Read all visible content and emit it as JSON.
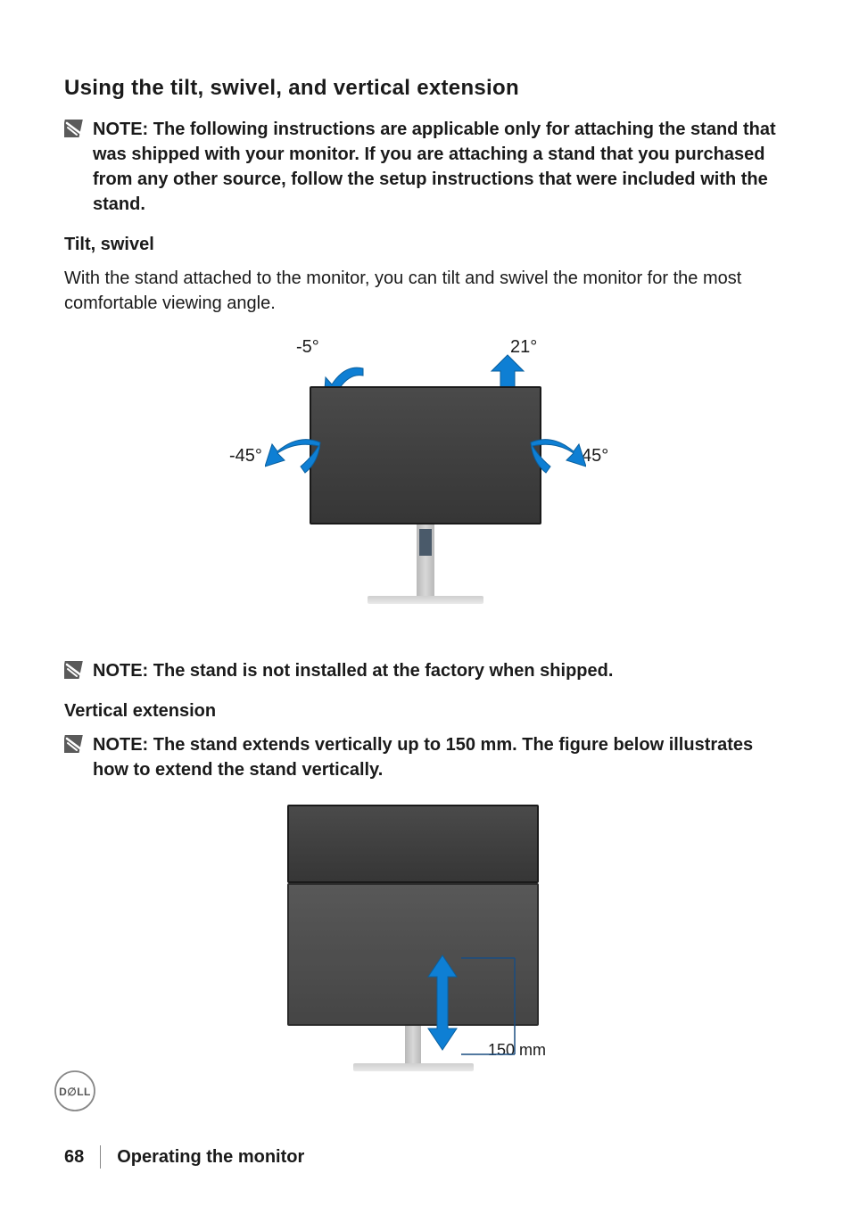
{
  "headings": {
    "main": "Using the tilt, swivel, and vertical extension",
    "tilt_swivel": "Tilt, swivel",
    "vertical_extension": "Vertical extension"
  },
  "notes": {
    "note1": "NOTE: The following instructions are applicable only for attaching the stand that was shipped with your monitor. If you are attaching a stand that you purchased from any other source, follow the setup instructions that were included with the stand.",
    "note2": "NOTE: The stand is not installed at the factory when shipped.",
    "note3": "NOTE: The stand extends vertically up to 150 mm. The figure below illustrates how to extend the stand vertically."
  },
  "body": {
    "tilt_swivel_desc": "With the stand attached to the monitor, you can tilt and swivel the monitor for the most comfortable viewing angle."
  },
  "figure_labels": {
    "tilt_neg5": "-5°",
    "tilt_21": "21°",
    "swivel_neg45": "-45°",
    "swivel_45": "45°",
    "vert_150mm": "150 mm"
  },
  "footer": {
    "page_number": "68",
    "section_title": "Operating the monitor"
  }
}
